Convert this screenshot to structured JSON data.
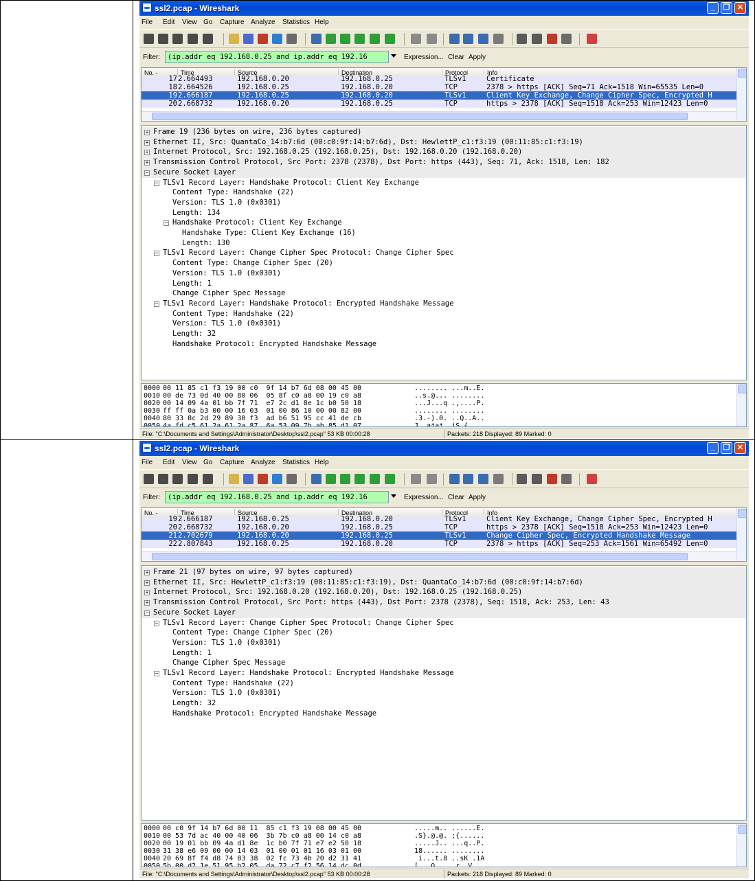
{
  "screens": [
    {
      "title": "ssl2.pcap - Wireshark",
      "menu": [
        "File",
        "Edit",
        "View",
        "Go",
        "Capture",
        "Analyze",
        "Statistics",
        "Help"
      ],
      "filter": {
        "label": "Filter:",
        "value": "(ip.addr eq 192.168.0.25 and ip.addr eq 192.16",
        "expression": "Expression...",
        "clear": "Clear",
        "apply": "Apply"
      },
      "columns": [
        "No. -",
        "Time",
        "Source",
        "Destination",
        "Protocol",
        "Info"
      ],
      "packets": [
        {
          "no": "17",
          "time": "2.664493",
          "src": "192.168.0.20",
          "dst": "192.168.0.25",
          "proto": "TLSv1",
          "info": "Certificate",
          "style": "tls"
        },
        {
          "no": "18",
          "time": "2.664526",
          "src": "192.168.0.25",
          "dst": "192.168.0.20",
          "proto": "TCP",
          "info": "2378 > https [ACK] Seq=71 Ack=1518 Win=65535 Len=0",
          "style": "tcp"
        },
        {
          "no": "19",
          "time": "2.666187",
          "src": "192.168.0.25",
          "dst": "192.168.0.20",
          "proto": "TLSv1",
          "info": "Client Key Exchange, Change Cipher Spec, Encrypted H",
          "style": "sel"
        },
        {
          "no": "20",
          "time": "2.668732",
          "src": "192.168.0.20",
          "dst": "192.168.0.25",
          "proto": "TCP",
          "info": "https > 2378 [ACK] Seq=1518 Ack=253 Win=12423 Len=0",
          "style": "tcp"
        }
      ],
      "details": [
        {
          "indent": 0,
          "toggle": "+",
          "text": "Frame 19 (236 bytes on wire, 236 bytes captured)",
          "hdr": true
        },
        {
          "indent": 0,
          "toggle": "+",
          "text": "Ethernet II, Src: QuantaCo_14:b7:6d (00:c0:9f:14:b7:6d), Dst: HewlettP_c1:f3:19 (00:11:85:c1:f3:19)",
          "hdr": true
        },
        {
          "indent": 0,
          "toggle": "+",
          "text": "Internet Protocol, Src: 192.168.0.25 (192.168.0.25), Dst: 192.168.0.20 (192.168.0.20)",
          "hdr": true
        },
        {
          "indent": 0,
          "toggle": "+",
          "text": "Transmission Control Protocol, Src Port: 2378 (2378), Dst Port: https (443), Seq: 71, Ack: 1518, Len: 182",
          "hdr": true
        },
        {
          "indent": 0,
          "toggle": "-",
          "text": "Secure Socket Layer",
          "hdr": true
        },
        {
          "indent": 1,
          "toggle": "-",
          "text": "TLSv1 Record Layer: Handshake Protocol: Client Key Exchange"
        },
        {
          "indent": 2,
          "toggle": "",
          "text": "Content Type: Handshake (22)"
        },
        {
          "indent": 2,
          "toggle": "",
          "text": "Version: TLS 1.0 (0x0301)"
        },
        {
          "indent": 2,
          "toggle": "",
          "text": "Length: 134"
        },
        {
          "indent": 2,
          "toggle": "-",
          "text": "Handshake Protocol: Client Key Exchange"
        },
        {
          "indent": 3,
          "toggle": "",
          "text": "Handshake Type: Client Key Exchange (16)"
        },
        {
          "indent": 3,
          "toggle": "",
          "text": "Length: 130"
        },
        {
          "indent": 1,
          "toggle": "-",
          "text": "TLSv1 Record Layer: Change Cipher Spec Protocol: Change Cipher Spec"
        },
        {
          "indent": 2,
          "toggle": "",
          "text": "Content Type: Change Cipher Spec (20)"
        },
        {
          "indent": 2,
          "toggle": "",
          "text": "Version: TLS 1.0 (0x0301)"
        },
        {
          "indent": 2,
          "toggle": "",
          "text": "Length: 1"
        },
        {
          "indent": 2,
          "toggle": "",
          "text": "Change Cipher Spec Message"
        },
        {
          "indent": 1,
          "toggle": "-",
          "text": "TLSv1 Record Layer: Handshake Protocol: Encrypted Handshake Message"
        },
        {
          "indent": 2,
          "toggle": "",
          "text": "Content Type: Handshake (22)"
        },
        {
          "indent": 2,
          "toggle": "",
          "text": "Version: TLS 1.0 (0x0301)"
        },
        {
          "indent": 2,
          "toggle": "",
          "text": "Length: 32"
        },
        {
          "indent": 2,
          "toggle": "",
          "text": "Handshake Protocol: Encrypted Handshake Message"
        }
      ],
      "hex": [
        {
          "off": "0000",
          "bytes": "00 11 85 c1 f3 19 00 c0  9f 14 b7 6d 08 00 45 00",
          "ascii": "........ ...m..E."
        },
        {
          "off": "0010",
          "bytes": "00 de 73 0d 40 00 80 06  05 8f c0 a8 00 19 c0 a8",
          "ascii": "..s.@... ........"
        },
        {
          "off": "0020",
          "bytes": "00 14 09 4a 01 bb 7f 71  e7 2c d1 8e 1c b0 50 18",
          "ascii": "...J...q .,....P."
        },
        {
          "off": "0030",
          "bytes": "ff ff 0a b3 00 00 16 03  01 00 86 10 00 00 82 00",
          "ascii": "........ ........"
        },
        {
          "off": "0040",
          "bytes": "80 33 8c 2d 29 89 30 f3  ad b6 51 95 cc 41 de cb",
          "ascii": ".3.-).0. ..Q..A.."
        },
        {
          "off": "0050",
          "bytes": "4a fd c5 61 2a 61 2a 87  6a 53 09 7b ab 85 d1 07",
          "ascii": "J..a*a*. jS.{...."
        }
      ],
      "status_file": "File: \"C:\\Documents and Settings\\Administrator\\Desktop\\ssl2.pcap\" 53 KB 00:00:28",
      "status_packets": "Packets: 218 Displayed: 89 Marked: 0"
    },
    {
      "title": "ssl2.pcap - Wireshark",
      "menu": [
        "File",
        "Edit",
        "View",
        "Go",
        "Capture",
        "Analyze",
        "Statistics",
        "Help"
      ],
      "filter": {
        "label": "Filter:",
        "value": "(ip.addr eq 192.168.0.25 and ip.addr eq 192.16",
        "expression": "Expression...",
        "clear": "Clear",
        "apply": "Apply"
      },
      "columns": [
        "No. -",
        "Time",
        "Source",
        "Destination",
        "Protocol",
        "Info"
      ],
      "packets": [
        {
          "no": "19",
          "time": "2.666187",
          "src": "192.168.0.25",
          "dst": "192.168.0.20",
          "proto": "TLSv1",
          "info": "Client Key Exchange, Change Cipher Spec, Encrypted H",
          "style": "tls"
        },
        {
          "no": "20",
          "time": "2.668732",
          "src": "192.168.0.20",
          "dst": "192.168.0.25",
          "proto": "TCP",
          "info": "https > 2378 [ACK] Seq=1518 Ack=253 Win=12423 Len=0",
          "style": "tcp"
        },
        {
          "no": "21",
          "time": "2.702679",
          "src": "192.168.0.20",
          "dst": "192.168.0.25",
          "proto": "TLSv1",
          "info": "Change Cipher Spec, Encrypted Handshake Message",
          "style": "sel"
        },
        {
          "no": "22",
          "time": "2.807843",
          "src": "192.168.0.25",
          "dst": "192.168.0.20",
          "proto": "TCP",
          "info": "2378 > https [ACK] Seq=253 Ack=1561 Win=65492 Len=0",
          "style": "tcp"
        }
      ],
      "details": [
        {
          "indent": 0,
          "toggle": "+",
          "text": "Frame 21 (97 bytes on wire, 97 bytes captured)",
          "hdr": true
        },
        {
          "indent": 0,
          "toggle": "+",
          "text": "Ethernet II, Src: HewlettP_c1:f3:19 (00:11:85:c1:f3:19), Dst: QuantaCo_14:b7:6d (00:c0:9f:14:b7:6d)",
          "hdr": true
        },
        {
          "indent": 0,
          "toggle": "+",
          "text": "Internet Protocol, Src: 192.168.0.20 (192.168.0.20), Dst: 192.168.0.25 (192.168.0.25)",
          "hdr": true
        },
        {
          "indent": 0,
          "toggle": "+",
          "text": "Transmission Control Protocol, Src Port: https (443), Dst Port: 2378 (2378), Seq: 1518, Ack: 253, Len: 43",
          "hdr": true
        },
        {
          "indent": 0,
          "toggle": "-",
          "text": "Secure Socket Layer",
          "hdr": true
        },
        {
          "indent": 1,
          "toggle": "-",
          "text": "TLSv1 Record Layer: Change Cipher Spec Protocol: Change Cipher Spec"
        },
        {
          "indent": 2,
          "toggle": "",
          "text": "Content Type: Change Cipher Spec (20)"
        },
        {
          "indent": 2,
          "toggle": "",
          "text": "Version: TLS 1.0 (0x0301)"
        },
        {
          "indent": 2,
          "toggle": "",
          "text": "Length: 1"
        },
        {
          "indent": 2,
          "toggle": "",
          "text": "Change Cipher Spec Message"
        },
        {
          "indent": 1,
          "toggle": "-",
          "text": "TLSv1 Record Layer: Handshake Protocol: Encrypted Handshake Message"
        },
        {
          "indent": 2,
          "toggle": "",
          "text": "Content Type: Handshake (22)"
        },
        {
          "indent": 2,
          "toggle": "",
          "text": "Version: TLS 1.0 (0x0301)"
        },
        {
          "indent": 2,
          "toggle": "",
          "text": "Length: 32"
        },
        {
          "indent": 2,
          "toggle": "",
          "text": "Handshake Protocol: Encrypted Handshake Message"
        }
      ],
      "hex": [
        {
          "off": "0000",
          "bytes": "00 c0 9f 14 b7 6d 00 11  85 c1 f3 19 08 00 45 00",
          "ascii": ".....m.. ......E."
        },
        {
          "off": "0010",
          "bytes": "00 53 7d ac 40 00 40 06  3b 7b c0 a8 00 14 c0 a8",
          "ascii": ".S}.@.@. ;{......"
        },
        {
          "off": "0020",
          "bytes": "00 19 01 bb 09 4a d1 8e  1c b0 7f 71 e7 e2 50 18",
          "ascii": ".....J.. ...q..P."
        },
        {
          "off": "0030",
          "bytes": "31 38 e6 09 00 00 14 03  01 00 01 01 16 03 01 00",
          "ascii": "18...... ........"
        },
        {
          "off": "0040",
          "bytes": "20 69 8f f4 d8 74 83 38  02 fc 73 4b 20 d2 31 41",
          "ascii": " i...t.8 ..sK .1A"
        },
        {
          "off": "0050",
          "bytes": "5b 00 d2 1e 51 95 b2 05  da 72 c7 f2 56 14 dc 0d",
          "ascii": "[...Q... .r..V..."
        }
      ],
      "status_file": "File: \"C:\\Documents and Settings\\Administrator\\Desktop\\ssl2.pcap\" 53 KB 00:00:28",
      "status_packets": "Packets: 218 Displayed: 89 Marked: 0"
    }
  ],
  "colors": {
    "title_bar": "#0a5ee6",
    "selected_row": "#316ac5",
    "filter_valid": "#afffaf",
    "tls_row": "#e6e6fa",
    "tcp_row": "#e7e6ff"
  },
  "toolbar_icons": [
    "interface-list-icon",
    "capture-options-icon",
    "start-capture-icon",
    "stop-capture-icon",
    "restart-capture-icon",
    "open-file-icon",
    "save-file-icon",
    "close-file-icon",
    "reload-icon",
    "print-icon",
    "find-packet-icon",
    "go-back-icon",
    "go-forward-icon",
    "go-to-packet-icon",
    "go-first-icon",
    "go-last-icon",
    "colorize-icon",
    "auto-scroll-icon",
    "zoom-in-icon",
    "zoom-out-icon",
    "zoom-normal-icon",
    "resize-columns-icon",
    "capture-filters-icon",
    "display-filters-icon",
    "coloring-rules-icon",
    "preferences-icon",
    "help-icon"
  ]
}
